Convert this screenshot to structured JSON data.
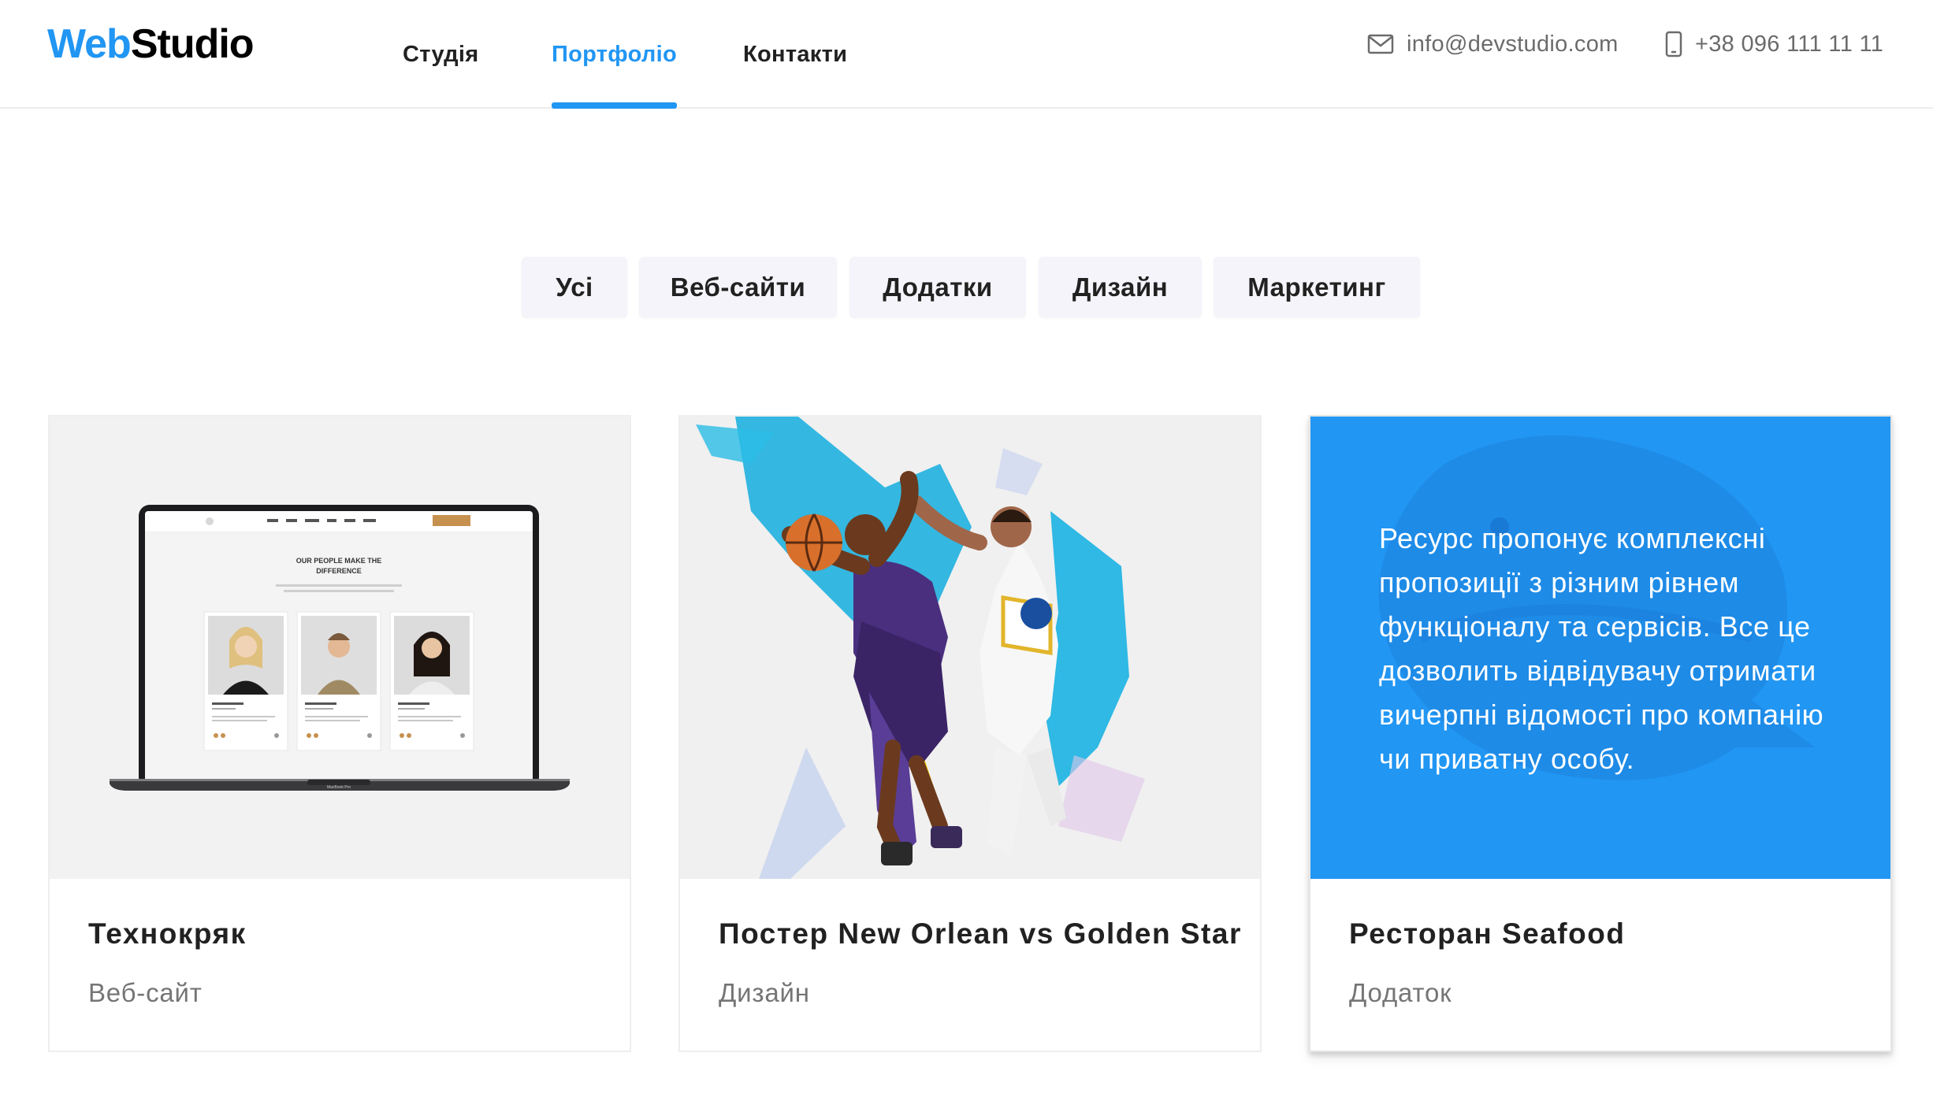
{
  "header": {
    "logo": {
      "part1": "Web",
      "part2": "Studio"
    },
    "nav": [
      {
        "label": "Студія",
        "active": false
      },
      {
        "label": "Портфоліо",
        "active": true
      },
      {
        "label": "Контакти",
        "active": false
      }
    ],
    "email": {
      "icon": "mail-icon",
      "text": "info@devstudio.com"
    },
    "phone": {
      "icon": "phone-icon",
      "text": "+38 096 111 11 11"
    }
  },
  "filters": {
    "items": [
      "Усі",
      "Веб-сайти",
      "Додатки",
      "Дизайн",
      "Маркетинг"
    ]
  },
  "portfolio": {
    "cards": [
      {
        "title": "Технокряк",
        "category": "Веб-сайт",
        "image": "laptop-website-mockup",
        "mockup": {
          "heading_line1": "OUR PEOPLE MAKE THE",
          "heading_line2": "DIFFERENCE",
          "laptop_label": "MacBook Pro"
        }
      },
      {
        "title": "Постер New Orlean vs Golden Star",
        "category": "Дизайн",
        "image": "basketball-poster"
      },
      {
        "title": "Ресторан Seafood",
        "category": "Додаток",
        "image": "seafood-restaurant",
        "overlay_text": "Ресурс пропонує комплексні пропозиції з різним рівнем функціоналу та сервісів. Все це дозволить відвідувачу отримати вичерпні відомості про компанію чи приватну особу."
      }
    ]
  },
  "colors": {
    "accent": "#2196f3",
    "text": "#212121",
    "muted": "#757575",
    "filter_bg": "#f5f4fa"
  }
}
